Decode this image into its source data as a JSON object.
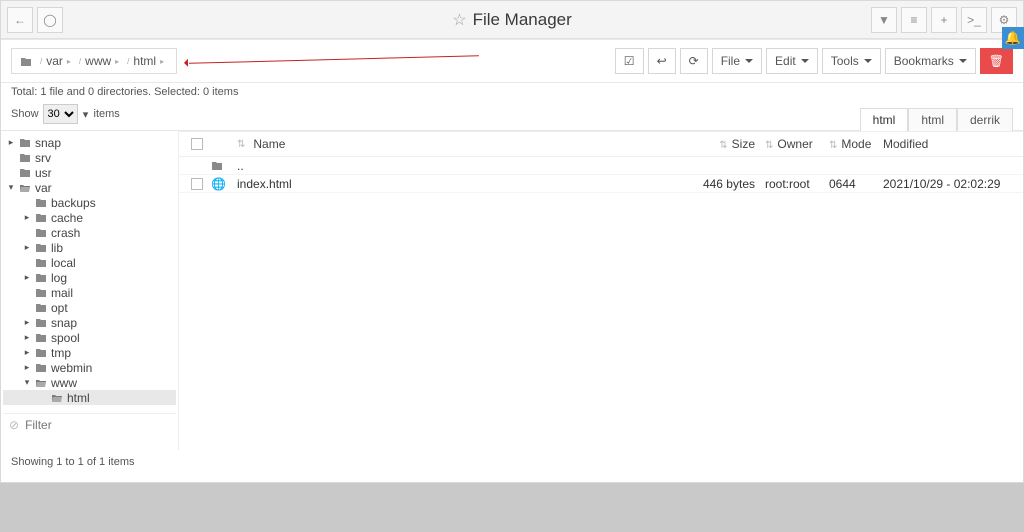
{
  "header": {
    "title": "File Manager"
  },
  "breadcrumb": [
    "var",
    "www",
    "html"
  ],
  "toolbar": {
    "file": "File",
    "edit": "Edit",
    "tools": "Tools",
    "bookmarks": "Bookmarks"
  },
  "status": "Total: 1 file and 0 directories. Selected: 0 items",
  "show": {
    "label": "Show",
    "value": "30",
    "suffix": "items"
  },
  "tabs": [
    "html",
    "html",
    "derrik"
  ],
  "active_tab": 0,
  "tree": [
    {
      "level": 0,
      "name": "snap",
      "caret": "▸",
      "open": false
    },
    {
      "level": 0,
      "name": "srv",
      "caret": "",
      "open": false
    },
    {
      "level": 0,
      "name": "usr",
      "caret": "",
      "open": false
    },
    {
      "level": 0,
      "name": "var",
      "caret": "▾",
      "open": true
    },
    {
      "level": 1,
      "name": "backups",
      "caret": "",
      "open": false
    },
    {
      "level": 1,
      "name": "cache",
      "caret": "▸",
      "open": false
    },
    {
      "level": 1,
      "name": "crash",
      "caret": "",
      "open": false
    },
    {
      "level": 1,
      "name": "lib",
      "caret": "▸",
      "open": false
    },
    {
      "level": 1,
      "name": "local",
      "caret": "",
      "open": false
    },
    {
      "level": 1,
      "name": "log",
      "caret": "▸",
      "open": false
    },
    {
      "level": 1,
      "name": "mail",
      "caret": "",
      "open": false
    },
    {
      "level": 1,
      "name": "opt",
      "caret": "",
      "open": false
    },
    {
      "level": 1,
      "name": "snap",
      "caret": "▸",
      "open": false
    },
    {
      "level": 1,
      "name": "spool",
      "caret": "▸",
      "open": false
    },
    {
      "level": 1,
      "name": "tmp",
      "caret": "▸",
      "open": false
    },
    {
      "level": 1,
      "name": "webmin",
      "caret": "▸",
      "open": false
    },
    {
      "level": 1,
      "name": "www",
      "caret": "▾",
      "open": true
    },
    {
      "level": 2,
      "name": "html",
      "caret": "",
      "open": true,
      "selected": true
    }
  ],
  "filter_placeholder": "Filter",
  "columns": {
    "name": "Name",
    "size": "Size",
    "owner": "Owner",
    "mode": "Mode",
    "modified": "Modified"
  },
  "parent_row": "..",
  "rows": [
    {
      "icon": "globe",
      "name": "index.html",
      "size": "446 bytes",
      "owner": "root:root",
      "mode": "0644",
      "modified": "2021/10/29 - 02:02:29"
    }
  ],
  "footer": "Showing 1 to 1 of 1 items"
}
